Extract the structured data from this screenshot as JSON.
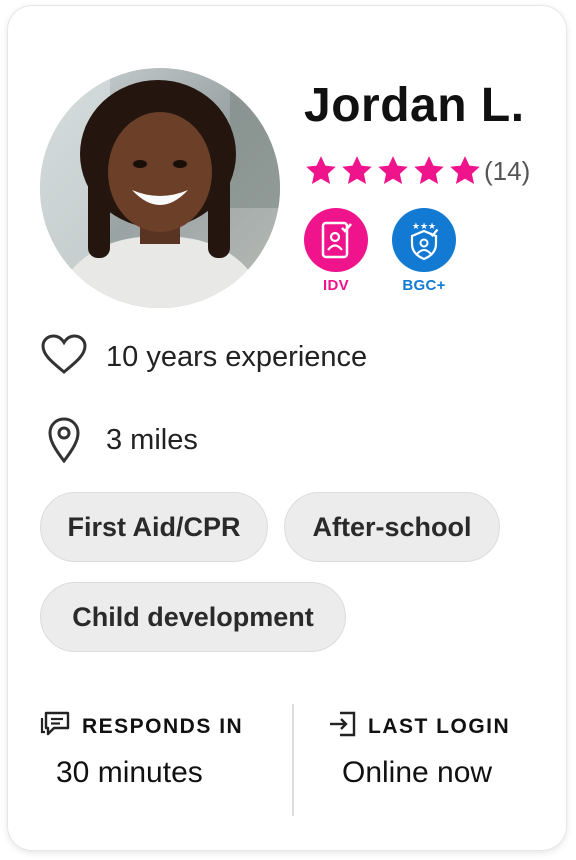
{
  "profile": {
    "name": "Jordan L.",
    "review_count": "(14)",
    "rating": 5,
    "rating_max": 5
  },
  "badges": [
    {
      "label": "IDV",
      "icon": "id-verified-icon",
      "color": "#f0148c"
    },
    {
      "label": "BGC+",
      "icon": "background-check-icon",
      "color": "#137ad4"
    }
  ],
  "details": {
    "experience": {
      "icon": "heart-icon",
      "text": "10 years experience"
    },
    "distance": {
      "icon": "location-pin-icon",
      "text": "3 miles"
    }
  },
  "skills": [
    "First Aid/CPR",
    "After-school",
    "Child development"
  ],
  "footer": {
    "responds": {
      "icon": "chat-icon",
      "label": "RESPONDS IN",
      "value": "30 minutes"
    },
    "last_login": {
      "icon": "sign-in-icon",
      "label": "LAST LOGIN",
      "value": "Online now"
    }
  },
  "colors": {
    "star": "#f0148c",
    "idv": "#f0148c",
    "bgc": "#137ad4",
    "chip_bg": "#ececec"
  }
}
